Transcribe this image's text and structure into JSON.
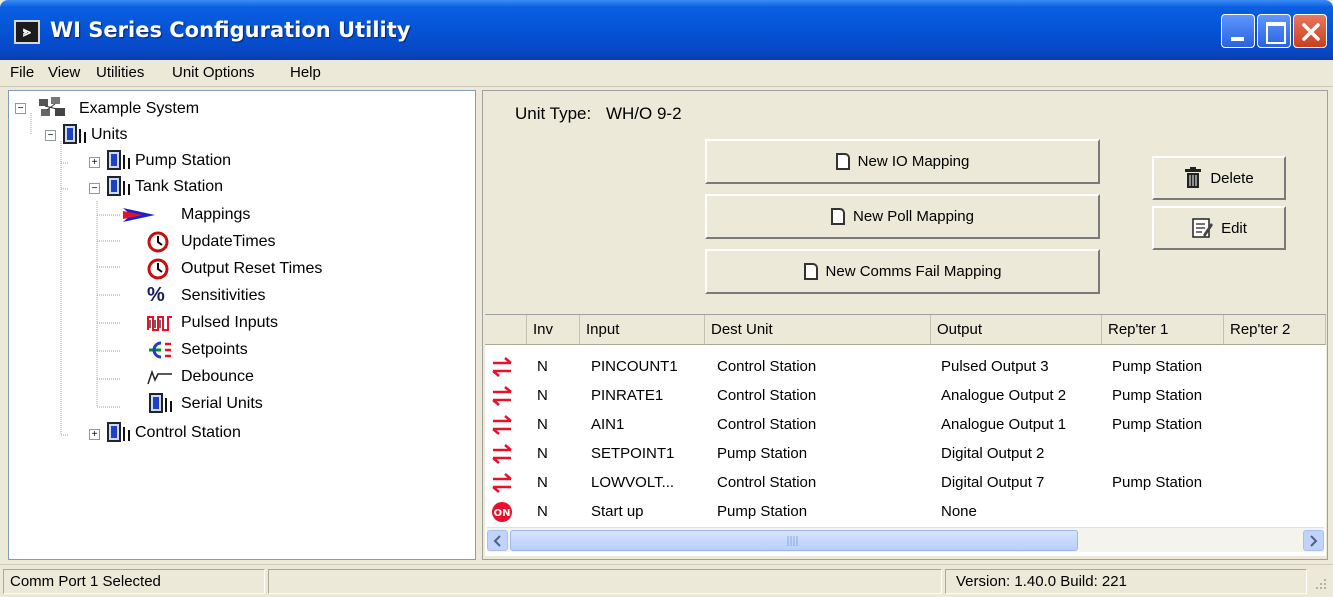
{
  "window": {
    "title": "WI Series Configuration Utility",
    "app_icon_glyph": "⪢"
  },
  "menu": [
    "File",
    "View",
    "Utilities",
    "Unit Options",
    "Help"
  ],
  "tree": {
    "root": "Example System",
    "units": "Units",
    "pump_station": "Pump Station",
    "tank_station": "Tank Station",
    "children": [
      "Mappings",
      "UpdateTimes",
      "Output Reset Times",
      "Sensitivities",
      "Pulsed Inputs",
      "Setpoints",
      "Debounce",
      "Serial Units"
    ],
    "control_station": "Control Station"
  },
  "unit_type": {
    "label": "Unit Type:",
    "value": "WH/O 9-2"
  },
  "buttons": {
    "new_io": "New IO Mapping",
    "new_poll": "New Poll Mapping",
    "new_comms": "New Comms Fail Mapping",
    "delete": "Delete",
    "edit": "Edit"
  },
  "table": {
    "columns": [
      "Inv",
      "Input",
      "Dest Unit",
      "Output",
      "Rep'ter 1",
      "Rep'ter 2"
    ],
    "rows": [
      {
        "icon": "bidirectional-arrows-icon",
        "inv": "N",
        "input": "PINCOUNT1",
        "dest": "Control Station",
        "output": "Pulsed Output 3",
        "rep1": "Pump Station",
        "rep2": ""
      },
      {
        "icon": "bidirectional-arrows-icon",
        "inv": "N",
        "input": "PINRATE1",
        "dest": "Control Station",
        "output": "Analogue Output 2",
        "rep1": "Pump Station",
        "rep2": ""
      },
      {
        "icon": "bidirectional-arrows-icon",
        "inv": "N",
        "input": "AIN1",
        "dest": "Control Station",
        "output": "Analogue Output 1",
        "rep1": "Pump Station",
        "rep2": ""
      },
      {
        "icon": "bidirectional-arrows-icon",
        "inv": "N",
        "input": "SETPOINT1",
        "dest": "Pump Station",
        "output": "Digital Output 2",
        "rep1": "",
        "rep2": ""
      },
      {
        "icon": "bidirectional-arrows-icon",
        "inv": "N",
        "input": "LOWVOLT...",
        "dest": "Control Station",
        "output": "Digital Output 7",
        "rep1": "Pump Station",
        "rep2": ""
      },
      {
        "icon": "on-badge-icon",
        "inv": "N",
        "input": "Start up",
        "dest": "Pump Station",
        "output": "None",
        "rep1": "",
        "rep2": "",
        "badge": "ON"
      }
    ]
  },
  "status": {
    "left": "Comm Port 1 Selected",
    "version": "Version: 1.40.0 Build: 221"
  },
  "colors": {
    "titlebar": "#0553d6",
    "arrow_red": "#e8102a",
    "panel": "#ece9d8"
  }
}
